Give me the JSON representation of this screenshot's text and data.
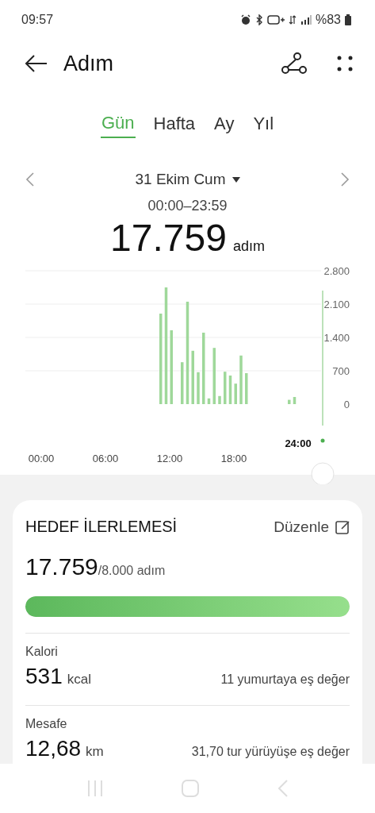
{
  "status_bar": {
    "time": "09:57",
    "battery": "%83"
  },
  "header": {
    "title": "Adım"
  },
  "tabs": [
    {
      "label": "Gün",
      "selected": true
    },
    {
      "label": "Hafta",
      "selected": false
    },
    {
      "label": "Ay",
      "selected": false
    },
    {
      "label": "Yıl",
      "selected": false
    }
  ],
  "day": {
    "date": "31 Ekim Cum",
    "range": "00:00–23:59",
    "total": "17.759",
    "unit": "adım"
  },
  "chart": {
    "cursor_label": "24:00",
    "chart_data": {
      "type": "bar",
      "x": [
        11,
        11.5,
        12,
        13,
        13.5,
        14,
        14.5,
        15,
        15.5,
        16,
        16.5,
        17,
        17.5,
        18,
        18.5,
        19,
        23,
        23.5
      ],
      "values": [
        1900,
        2450,
        1550,
        880,
        2150,
        1120,
        670,
        1500,
        120,
        1180,
        170,
        680,
        600,
        430,
        1020,
        650,
        90,
        150
      ],
      "grid": true,
      "xlim": [
        0,
        24
      ],
      "ylim": [
        0,
        2800
      ],
      "xticks": [
        {
          "value": 0,
          "label": "00:00"
        },
        {
          "value": 6,
          "label": "06:00"
        },
        {
          "value": 12,
          "label": "12:00"
        },
        {
          "value": 18,
          "label": "18:00"
        }
      ],
      "yticks": [
        {
          "value": 0,
          "label": "0"
        },
        {
          "value": 700,
          "label": "700"
        },
        {
          "value": 1400,
          "label": "1.400"
        },
        {
          "value": 2100,
          "label": "2.100"
        },
        {
          "value": 2800,
          "label": "2.800"
        }
      ]
    }
  },
  "goal": {
    "title": "HEDEF İLERLEMESİ",
    "edit": "Düzenle",
    "value": "17.759",
    "target": "/8.000 adım",
    "level": 1
  },
  "stats": [
    {
      "label": "Kalori",
      "value": "531",
      "unit": "kcal",
      "note": "11 yumurtaya eş değer"
    },
    {
      "label": "Mesafe",
      "value": "12,68",
      "unit": "km",
      "note": "31,70 tur yürüyüşe eş değer"
    }
  ]
}
